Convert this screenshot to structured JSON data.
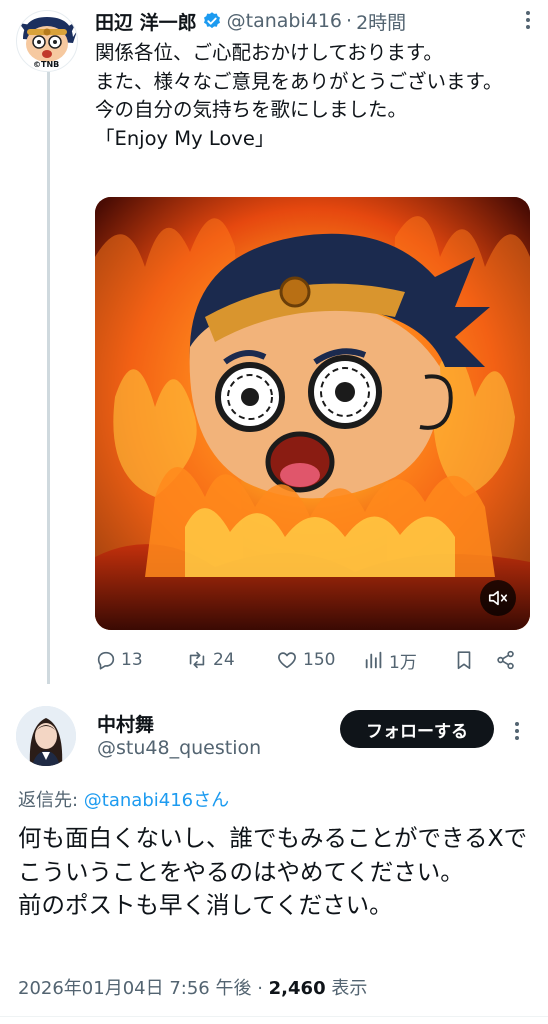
{
  "tweet1": {
    "author_name": "田辺 洋一郎",
    "author_handle": "@tanabi416",
    "time_sep": "·",
    "time": "2時間",
    "avatar_badge": "©TNB",
    "text": "関係各位、ご心配おかけしております。\nまた、様々なご意見をありがとうございます。\n今の自分の気持ちを歌にしました。\n「Enjoy My Love」",
    "actions": {
      "replies": "13",
      "retweets": "24",
      "likes": "150",
      "views": "1万"
    }
  },
  "reply": {
    "author_name": "中村舞",
    "author_handle": "@stu48_question",
    "follow_label": "フォローする",
    "replying_prefix": "返信先: ",
    "replying_to": "@tanabi416さん",
    "text": "何も面白くないし、誰でもみることができるXでこういうことをやるのはやめてください。\n前のポストも早く消してください。",
    "timestamp": "2026年01月04日 7:56 午後",
    "meta_sep": " · ",
    "views_count": "2,460",
    "views_label": " 表示"
  },
  "colors": {
    "text_primary": "#0f1419",
    "text_secondary": "#536471",
    "link": "#1d9bf0",
    "verified": "#1d9bf0",
    "follow_bg": "#0f1419"
  },
  "icons": [
    "verified-badge-icon",
    "more-options-icon",
    "reply-icon",
    "retweet-icon",
    "like-icon",
    "views-icon",
    "bookmark-icon",
    "share-icon",
    "mute-icon"
  ]
}
